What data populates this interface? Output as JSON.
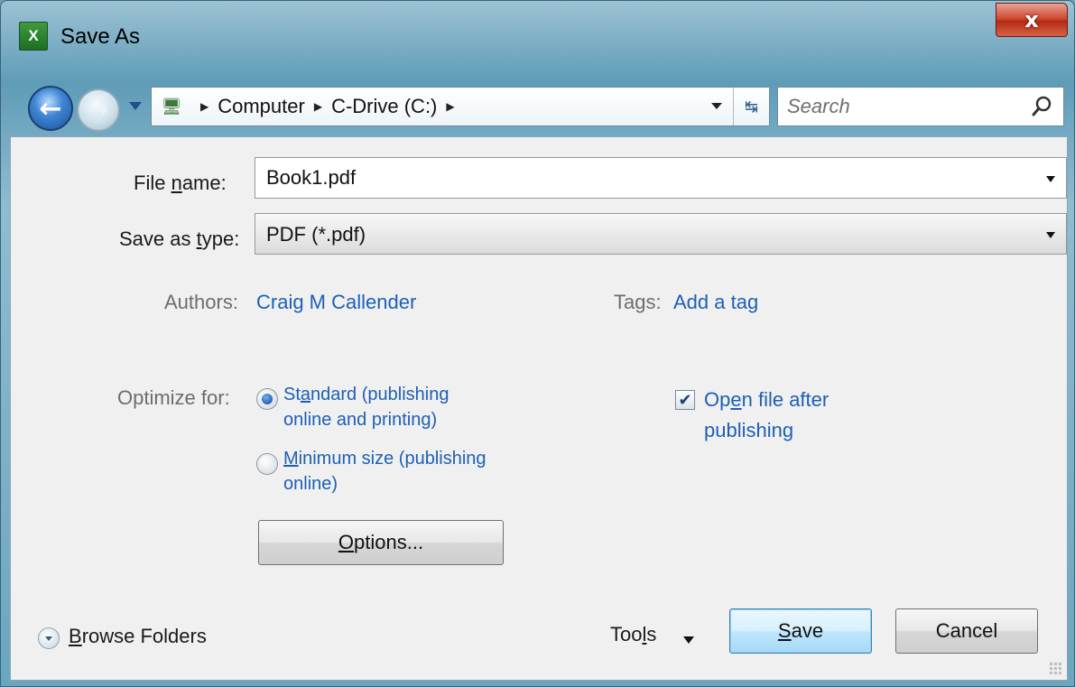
{
  "window": {
    "title": "Save As",
    "app_icon_text": "X",
    "close_label": "x"
  },
  "nav": {
    "back_glyph": "←",
    "forward_glyph": "→",
    "breadcrumb": [
      "Computer",
      "C-Drive (C:)"
    ],
    "refresh_glyph": "↹",
    "search_placeholder": "Search"
  },
  "form": {
    "file_name_label_pre": "File ",
    "file_name_label_key": "n",
    "file_name_label_post": "ame:",
    "file_name_value": "Book1.pdf",
    "save_type_label_pre": "Save as ",
    "save_type_label_key": "t",
    "save_type_label_post": "ype:",
    "save_type_value": "PDF (*.pdf)",
    "authors_label": "Authors:",
    "authors_value": "Craig M Callender",
    "tags_label": "Tags:",
    "tags_value": "Add a tag"
  },
  "optimize": {
    "label": "Optimize for:",
    "standard_pre": "St",
    "standard_key": "a",
    "standard_post": "ndard (publishing",
    "standard_line2": "online and printing)",
    "standard_checked": true,
    "minimum_key": "M",
    "minimum_post": "inimum size (publishing",
    "minimum_line2": "online)",
    "minimum_checked": false,
    "options_key": "O",
    "options_post": "ptions...",
    "open_after_pre": "Op",
    "open_after_key": "e",
    "open_after_post": "n file after",
    "open_after_line2": "publishing",
    "open_after_checked": true
  },
  "footer": {
    "browse_key": "B",
    "browse_post": "rowse Folders",
    "tools_pre": "Too",
    "tools_key": "l",
    "tools_post": "s",
    "save_key": "S",
    "save_post": "ave",
    "cancel_label": "Cancel"
  },
  "colors": {
    "link": "#1e5fb6",
    "close_red": "#c2381d",
    "panel": "#f0f0f0"
  }
}
